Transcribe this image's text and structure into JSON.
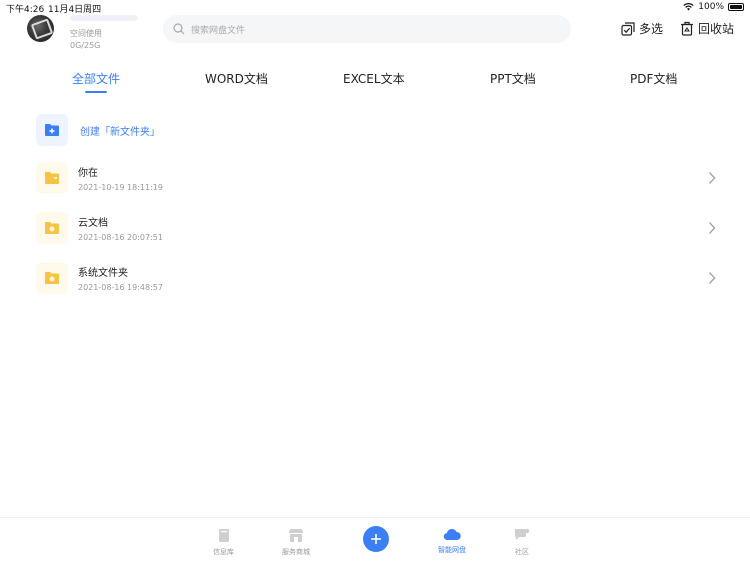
{
  "status": {
    "time": "下午4:26",
    "date": "11月4日周四",
    "battery": "100%"
  },
  "header": {
    "space_label": "空间使用",
    "space_value": "0G/25G",
    "search_placeholder": "搜索网盘文件",
    "multi_select": "多选",
    "recycle_bin": "回收站"
  },
  "tabs": [
    "全部文件",
    "WORD文档",
    "EXCEL文本",
    "PPT文档",
    "PDF文档"
  ],
  "create_label": "创建「新文件夹」",
  "files": [
    {
      "name": "你在",
      "date": "2021-10-19 18:11:19",
      "icon": "folder-icon"
    },
    {
      "name": "云文档",
      "date": "2021-08-16 20:07:51",
      "icon": "cloud-folder-icon"
    },
    {
      "name": "系统文件夹",
      "date": "2021-08-16 19:48:57",
      "icon": "system-folder-icon"
    }
  ],
  "bottom_nav": {
    "info": "信息库",
    "service": "服务商城",
    "cloud": "智能网盘",
    "community": "社区"
  },
  "colors": {
    "accent": "#3c7ff5",
    "folder": "#f6c343"
  }
}
